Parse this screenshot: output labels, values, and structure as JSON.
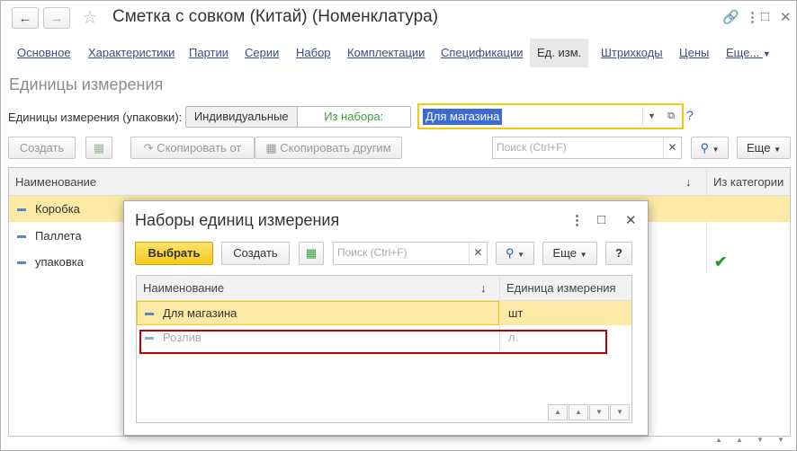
{
  "window": {
    "title": "Сметка с совком (Китай) (Номенклатура)"
  },
  "tabs": [
    "Основное",
    "Характеристики",
    "Партии",
    "Серии",
    "Набор",
    "Комплектации",
    "Спецификации",
    "Ед. изм.",
    "Штрихкоды",
    "Цены",
    "Еще..."
  ],
  "active_tab": "Ед. изм.",
  "section_title": "Единицы измерения",
  "units_filter": {
    "label": "Единицы измерения (упаковки):",
    "option_individual": "Индивидуальные",
    "option_from_set": "Из набора:",
    "set_value": "Для магазина",
    "help": "?"
  },
  "toolbar": {
    "create": "Создать",
    "copy_from": "Скопировать от",
    "copy_to_others": "Скопировать другим",
    "search_placeholder": "Поиск (Ctrl+F)",
    "more": "Еще"
  },
  "main_table": {
    "columns": [
      "Наименование",
      "Из категории"
    ],
    "rows": [
      {
        "name": "Коробка",
        "from_category": false,
        "selected": true
      },
      {
        "name": "Паллета",
        "from_category": false,
        "selected": false
      },
      {
        "name": "упаковка",
        "from_category": true,
        "selected": false
      }
    ]
  },
  "dialog": {
    "title": "Наборы единиц измерения",
    "choose": "Выбрать",
    "create": "Создать",
    "search_placeholder": "Поиск (Ctrl+F)",
    "more": "Еще",
    "help": "?",
    "columns": [
      "Наименование",
      "Единица измерения"
    ],
    "rows": [
      {
        "name": "Для магазина",
        "unit": "шт",
        "selected": true
      },
      {
        "name": "Розлив",
        "unit": "л.",
        "selected": false
      }
    ]
  }
}
